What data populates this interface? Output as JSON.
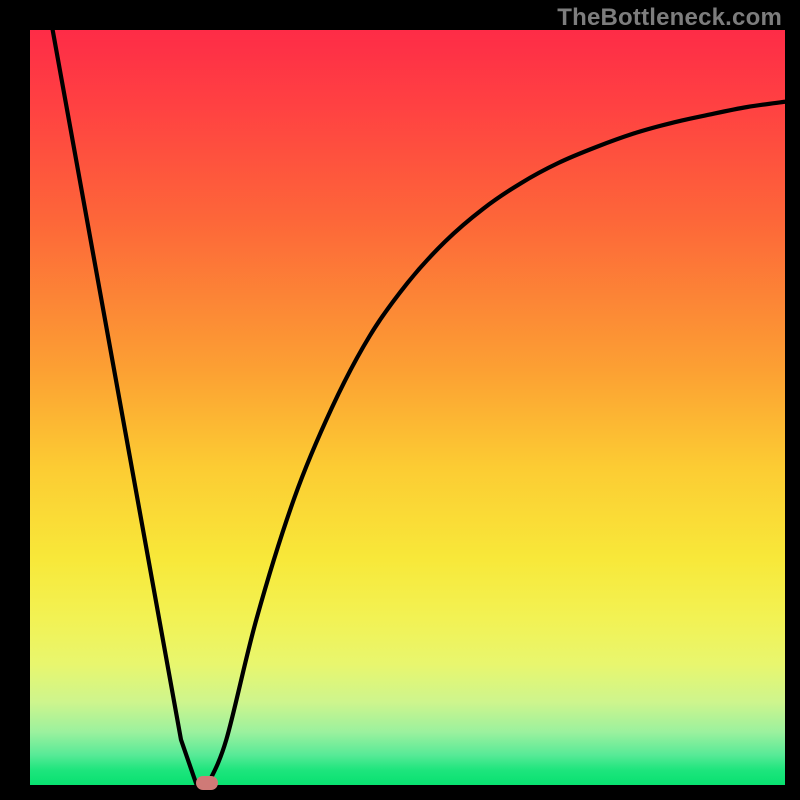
{
  "watermark": "TheBottleneck.com",
  "chart_data": {
    "type": "line",
    "title": "",
    "xlabel": "",
    "ylabel": "",
    "xlim": [
      0,
      100
    ],
    "ylim": [
      0,
      100
    ],
    "grid": false,
    "legend": false,
    "series": [
      {
        "name": "left-segment",
        "x": [
          3,
          20,
          22,
          23.5
        ],
        "values": [
          100,
          6,
          0.2,
          0
        ]
      },
      {
        "name": "right-curve",
        "x": [
          23.5,
          26,
          30,
          35,
          40,
          45,
          50,
          55,
          60,
          65,
          70,
          75,
          80,
          85,
          90,
          95,
          100
        ],
        "values": [
          0,
          6,
          22,
          38,
          50,
          59.5,
          66.5,
          72,
          76.3,
          79.7,
          82.4,
          84.5,
          86.3,
          87.7,
          88.8,
          89.8,
          90.5
        ]
      }
    ],
    "marker": {
      "x": 23.5,
      "y": 0,
      "color": "#cf7a77"
    },
    "colors": {
      "curve": "#000000",
      "background_top": "#fe2c47",
      "background_bottom": "#08e170",
      "frame": "#000000"
    }
  }
}
